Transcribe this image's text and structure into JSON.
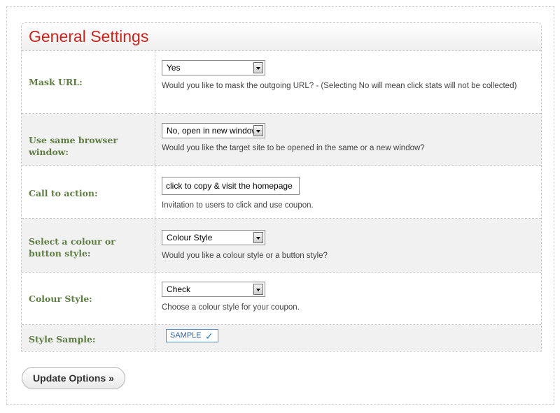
{
  "panel": {
    "title": "General Settings"
  },
  "rows": [
    {
      "label": "Mask URL:",
      "select_value": "Yes",
      "description": "Would you like to mask the outgoing URL? - (Selecting No will mean click stats will not be collected)"
    },
    {
      "label": "Use same browser window:",
      "select_value": "No, open in new window",
      "description": "Would you like the target site to be opened in the same or a new window?"
    },
    {
      "label": "Call to action:",
      "input_value": "click to copy & visit the homepage",
      "description": "Invitation to users to click and use coupon."
    },
    {
      "label": "Select a colour or button style:",
      "select_value": "Colour Style",
      "description": "Would you like a colour style or a button style?"
    },
    {
      "label": "Colour Style:",
      "select_value": "Check",
      "description": "Choose a colour style for your coupon."
    },
    {
      "label": "Style Sample:",
      "sample_label": "SAMPLE",
      "sample_icon": "checkmark-icon",
      "sample_color": "#2a7fd0"
    }
  ],
  "actions": {
    "update_label": "Update Options »"
  },
  "colors": {
    "title": "#c9251f",
    "label": "#5e7e43",
    "alt_row": "#f1f1f1"
  }
}
